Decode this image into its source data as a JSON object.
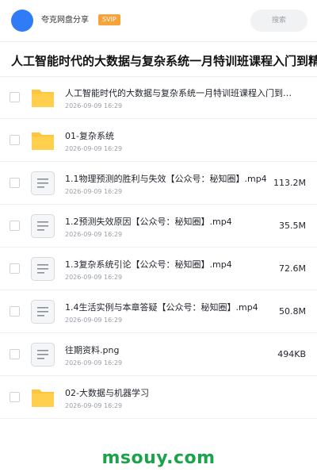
{
  "header": {
    "title": "夸克网盘分享",
    "badge": "SVIP",
    "search_label": "搜索"
  },
  "folder_title": "人工智能时代的大数据与复杂系统一月特训班课程入门到精通",
  "files": [
    {
      "name": "人工智能时代的大数据与复杂系统一月特训班课程入门到精通",
      "date": "2026-09-09 16:29",
      "size": "",
      "icon": "folder-icon"
    },
    {
      "name": "01-复杂系统",
      "date": "2026-09-09 16:29",
      "size": "",
      "icon": "folder-icon"
    },
    {
      "name": "1.1物理预测的胜利与失效【公众号：秘知圈】.mp4",
      "date": "2026-09-09 16:29",
      "size": "113.2M",
      "icon": "document-icon"
    },
    {
      "name": "1.2预测失效原因【公众号：秘知圈】.mp4",
      "date": "2026-09-09 16:29",
      "size": "35.5M",
      "icon": "document-icon"
    },
    {
      "name": "1.3复杂系统引论【公众号：秘知圈】.mp4",
      "date": "2026-09-09 16:29",
      "size": "72.6M",
      "icon": "document-icon"
    },
    {
      "name": "1.4生活实例与本章答疑【公众号：秘知圈】.mp4",
      "date": "2026-09-09 16:29",
      "size": "50.8M",
      "icon": "document-icon"
    },
    {
      "name": "往期资料.png",
      "date": "2026-09-09 16:29",
      "size": "494KB",
      "icon": "document-icon"
    },
    {
      "name": "02-大数据与机器学习",
      "date": "2026-09-09 16:29",
      "size": "",
      "icon": "folder-icon"
    }
  ],
  "watermark": "msouy.com",
  "colors": {
    "avatar": "#2f7cf6",
    "svip": "#f7a23b",
    "folder": "#ffc53d",
    "watermark": "#1aa34a"
  }
}
